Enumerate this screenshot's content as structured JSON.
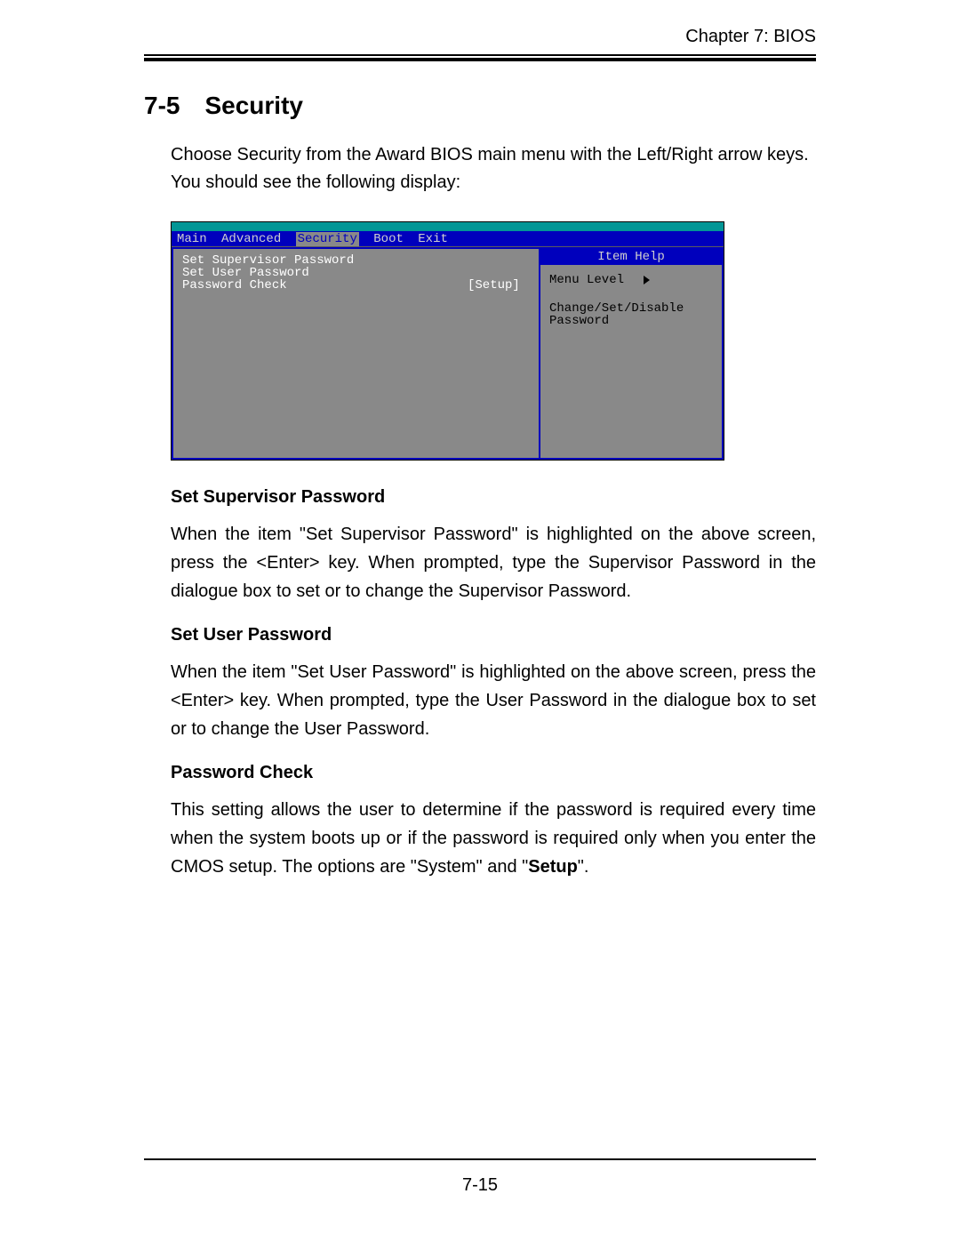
{
  "header": {
    "chapter": "Chapter 7: BIOS"
  },
  "section": {
    "number": "7-5",
    "title": "Security"
  },
  "intro": "Choose Security from the Award BIOS main menu with the Left/Right arrow keys. You should see the following display:",
  "bios": {
    "menu": [
      "Main",
      "Advanced",
      "Security",
      "Boot",
      "Exit"
    ],
    "selected_menu_index": 2,
    "items": [
      {
        "label": "Set Supervisor Password",
        "value": ""
      },
      {
        "label": "Set User Password",
        "value": ""
      },
      {
        "label": "Password Check",
        "value": "[Setup]"
      }
    ],
    "help": {
      "title": "Item Help",
      "menu_level_label": "Menu Level",
      "text": "Change/Set/Disable\nPassword"
    }
  },
  "subsections": [
    {
      "title": "Set Supervisor Password",
      "text": "When the item \"Set Supervisor Password\" is highlighted on the above screen, press the <Enter> key. When prompted, type the Supervisor Password in the dialogue box to set or to change the Supervisor Password."
    },
    {
      "title": "Set User Password",
      "text": "When the item \"Set User Password\" is highlighted on the above screen, press the <Enter> key. When prompted, type the User Password in the dialogue box to set or to change the User Password."
    },
    {
      "title": "Password Check",
      "text_prefix": "This setting allows the user to determine if the password is required every time when the system boots up or if the password is required only when you enter the CMOS setup.  The options are \"System\" and \"",
      "bold": "Setup",
      "text_suffix": "\"."
    }
  ],
  "page_number": "7-15"
}
